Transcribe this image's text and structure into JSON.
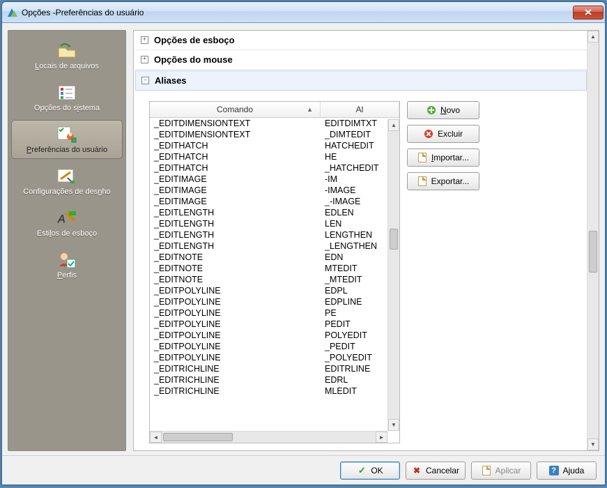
{
  "window": {
    "title": "Opções -Preferências do usuário"
  },
  "sidebar": {
    "items": [
      {
        "label": "Locais de arquivos",
        "u_index": 0
      },
      {
        "label": "Opções do sistema",
        "u_index": 10
      },
      {
        "label": "Preferências do usuário",
        "u_index": 0
      },
      {
        "label": "Configurações de desnho",
        "u_index": 20
      },
      {
        "label": "Estilos de esboço",
        "u_index": 4
      },
      {
        "label": "Perfis",
        "u_index": 0
      }
    ]
  },
  "tree": {
    "sketch": "Opções de esboço",
    "mouse": "Opções do mouse",
    "aliases": "Aliases"
  },
  "table": {
    "col1": "Comando",
    "col2": "Al",
    "rows": [
      {
        "cmd": "_EDITDIMENSIONTEXT",
        "alias": "EDITDIMTXT"
      },
      {
        "cmd": "_EDITDIMENSIONTEXT",
        "alias": "_DIMTEDIT"
      },
      {
        "cmd": "_EDITHATCH",
        "alias": "HATCHEDIT"
      },
      {
        "cmd": "_EDITHATCH",
        "alias": "HE"
      },
      {
        "cmd": "_EDITHATCH",
        "alias": "_HATCHEDIT"
      },
      {
        "cmd": "_EDITIMAGE",
        "alias": "-IM"
      },
      {
        "cmd": "_EDITIMAGE",
        "alias": "-IMAGE"
      },
      {
        "cmd": "_EDITIMAGE",
        "alias": "_-IMAGE"
      },
      {
        "cmd": "_EDITLENGTH",
        "alias": "EDLEN"
      },
      {
        "cmd": "_EDITLENGTH",
        "alias": "LEN"
      },
      {
        "cmd": "_EDITLENGTH",
        "alias": "LENGTHEN"
      },
      {
        "cmd": "_EDITLENGTH",
        "alias": "_LENGTHEN"
      },
      {
        "cmd": "_EDITNOTE",
        "alias": "EDN"
      },
      {
        "cmd": "_EDITNOTE",
        "alias": "MTEDIT"
      },
      {
        "cmd": "_EDITNOTE",
        "alias": "_MTEDIT"
      },
      {
        "cmd": "_EDITPOLYLINE",
        "alias": "EDPL"
      },
      {
        "cmd": "_EDITPOLYLINE",
        "alias": "EDPLINE"
      },
      {
        "cmd": "_EDITPOLYLINE",
        "alias": "PE"
      },
      {
        "cmd": "_EDITPOLYLINE",
        "alias": "PEDIT"
      },
      {
        "cmd": "_EDITPOLYLINE",
        "alias": "POLYEDIT"
      },
      {
        "cmd": "_EDITPOLYLINE",
        "alias": "_PEDIT"
      },
      {
        "cmd": "_EDITPOLYLINE",
        "alias": "_POLYEDIT"
      },
      {
        "cmd": "_EDITRICHLINE",
        "alias": "EDITRLINE"
      },
      {
        "cmd": "_EDITRICHLINE",
        "alias": "EDRL"
      },
      {
        "cmd": "_EDITRICHLINE",
        "alias": "MLEDIT"
      }
    ]
  },
  "buttons": {
    "novo": "Novo",
    "excluir": "Excluir",
    "importar": "Importar...",
    "exportar": "Exportar..."
  },
  "footer": {
    "ok": "OK",
    "cancel": "Cancelar",
    "apply": "Aplicar",
    "help": "Ajuda"
  }
}
